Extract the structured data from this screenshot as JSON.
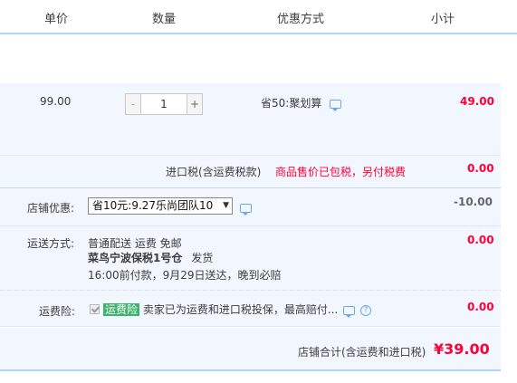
{
  "header": {
    "col_price": "单价",
    "col_qty": "数量",
    "col_promo": "优惠方式",
    "col_subtotal": "小计"
  },
  "item": {
    "unit_price": "99.00",
    "quantity": "1",
    "minus": "-",
    "plus": "+",
    "promo": "省50:聚划算",
    "subtotal": "49.00"
  },
  "tax": {
    "label": "进口税(含运费税款)",
    "note": "商品售价已包税，另付税费",
    "value": "0.00"
  },
  "store_discount": {
    "label": "店铺优惠:",
    "selected": "省10元:9.27乐尚团队10",
    "value": "-10.00"
  },
  "shipping": {
    "label": "运送方式:",
    "method": "普通配送 运费 免邮",
    "warehouse": "菜鸟宁波保税1号仓",
    "ship_word": "发货",
    "eta": "16:00前付款，9月29日送达，晚到必赔",
    "value": "0.00"
  },
  "insurance": {
    "label": "运费险:",
    "tag": "运费险",
    "desc": "卖家已为运费和进口税投保，最高赔付...",
    "qmark": "?",
    "value": "0.00"
  },
  "total": {
    "label": "店铺合计(含运费和进口税)",
    "value": "¥39.00"
  },
  "colors": {
    "red": "#ff0036",
    "row_bg": "#f2f7ff",
    "header_border": "#b2d1ff",
    "insure_green": "#3bb36b"
  }
}
